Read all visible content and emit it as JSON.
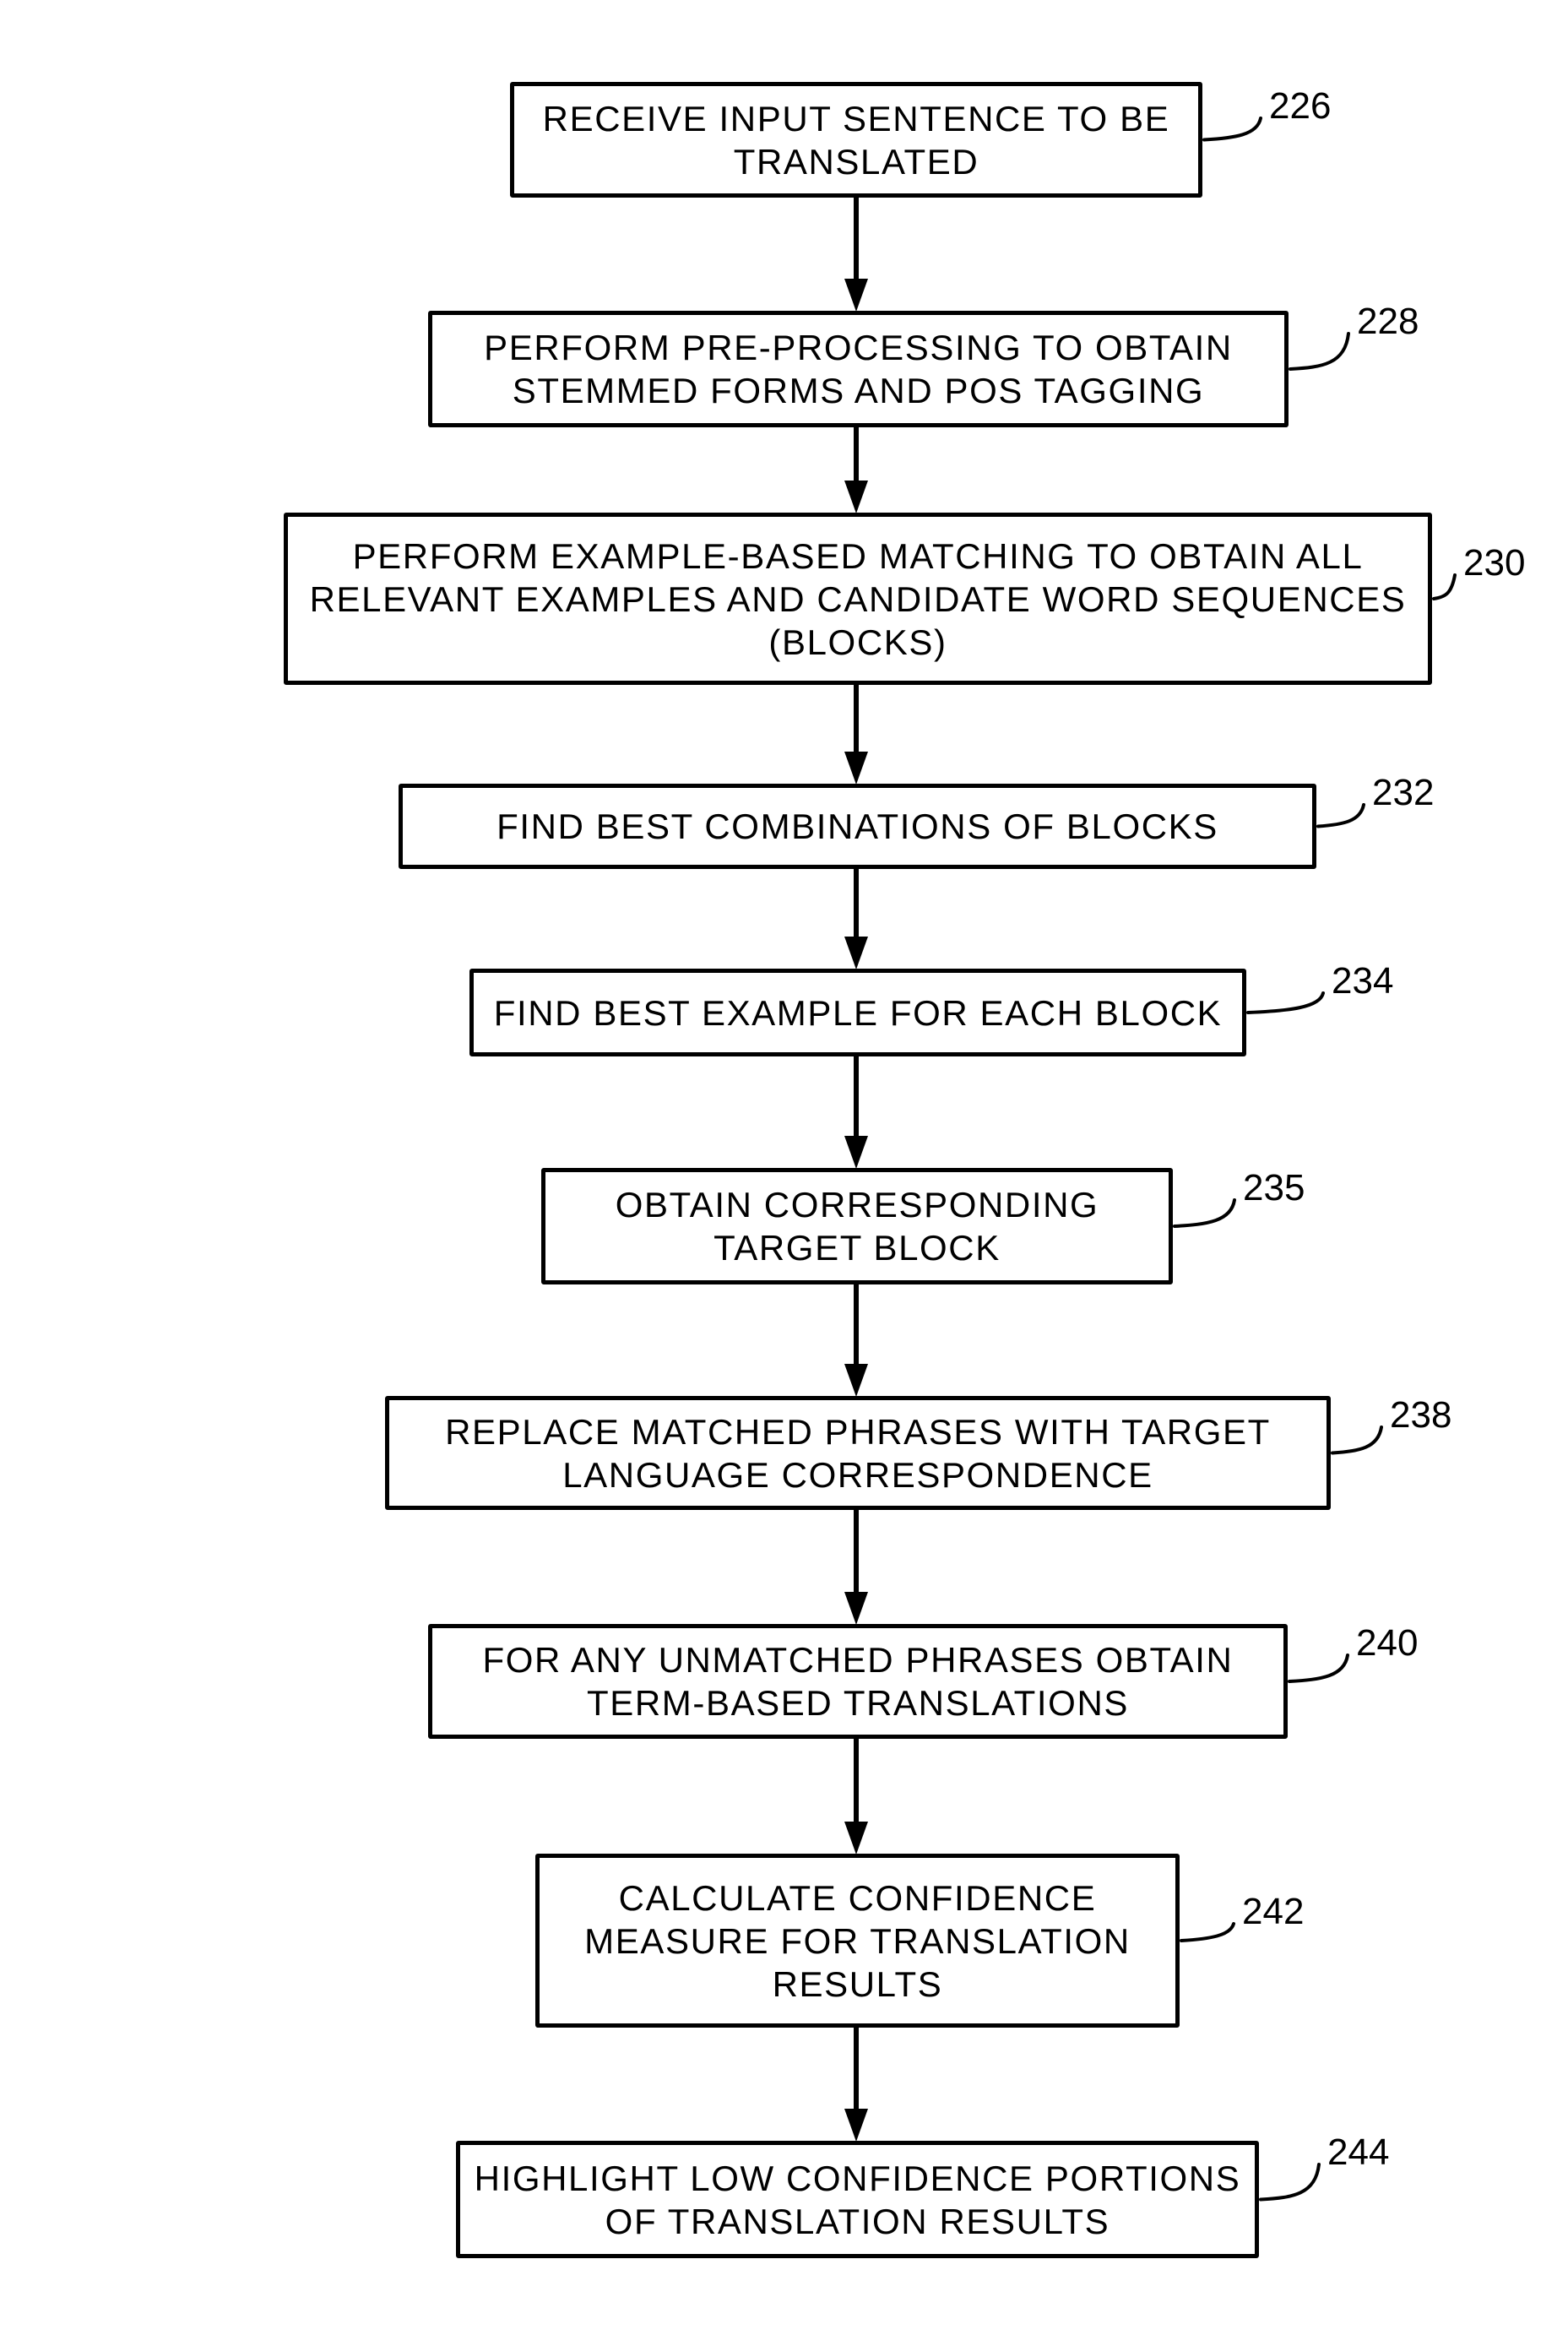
{
  "diagram": {
    "type": "flowchart",
    "direction": "top-to-bottom",
    "steps": [
      {
        "ref": "226",
        "text": "RECEIVE INPUT SENTENCE TO BE\nTRANSLATED"
      },
      {
        "ref": "228",
        "text": "PERFORM PRE-PROCESSING TO OBTAIN\nSTEMMED FORMS AND POS TAGGING"
      },
      {
        "ref": "230",
        "text": "PERFORM EXAMPLE-BASED MATCHING TO OBTAIN ALL\nRELEVANT EXAMPLES AND CANDIDATE WORD SEQUENCES\n(BLOCKS)"
      },
      {
        "ref": "232",
        "text": "FIND BEST COMBINATIONS OF BLOCKS"
      },
      {
        "ref": "234",
        "text": "FIND BEST EXAMPLE FOR EACH BLOCK"
      },
      {
        "ref": "235",
        "text": "OBTAIN CORRESPONDING\nTARGET BLOCK"
      },
      {
        "ref": "238",
        "text": "REPLACE MATCHED PHRASES WITH TARGET\nLANGUAGE CORRESPONDENCE"
      },
      {
        "ref": "240",
        "text": "FOR ANY UNMATCHED PHRASES OBTAIN\nTERM-BASED TRANSLATIONS"
      },
      {
        "ref": "242",
        "text": "CALCULATE CONFIDENCE\nMEASURE FOR TRANSLATION\nRESULTS"
      },
      {
        "ref": "244",
        "text": "HIGHLIGHT LOW CONFIDENCE PORTIONS\nOF TRANSLATION RESULTS"
      }
    ],
    "edges": [
      {
        "from": "226",
        "to": "228"
      },
      {
        "from": "228",
        "to": "230"
      },
      {
        "from": "230",
        "to": "232"
      },
      {
        "from": "232",
        "to": "234"
      },
      {
        "from": "234",
        "to": "235"
      },
      {
        "from": "235",
        "to": "238"
      },
      {
        "from": "238",
        "to": "240"
      },
      {
        "from": "240",
        "to": "242"
      },
      {
        "from": "242",
        "to": "244"
      }
    ],
    "colors": {
      "stroke": "#000000",
      "background": "#ffffff"
    }
  }
}
